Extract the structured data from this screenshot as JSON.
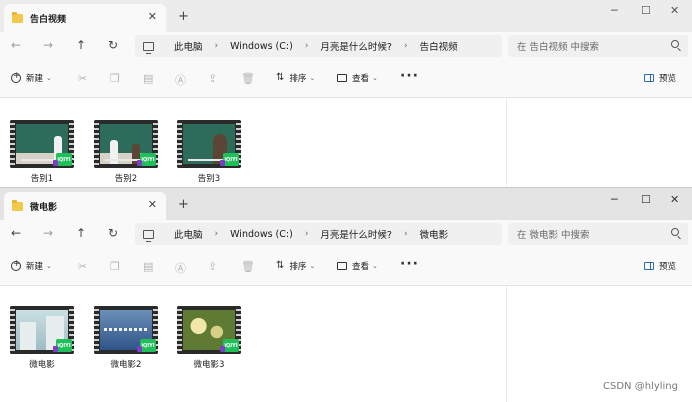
{
  "windows": [
    {
      "tab_title": "告白视频",
      "breadcrumb": [
        "此电脑",
        "Windows (C:)",
        "月亮是什么时候?",
        "告白视频"
      ],
      "search_placeholder": "在 告白视频 中搜索",
      "files": [
        {
          "name": "告别1",
          "thumbnail": "classroom-scene"
        },
        {
          "name": "告别2",
          "thumbnail": "classroom-scene"
        },
        {
          "name": "告别3",
          "thumbnail": "classroom-scene"
        }
      ]
    },
    {
      "tab_title": "微电影",
      "breadcrumb": [
        "此电脑",
        "Windows (C:)",
        "月亮是什么时候?",
        "微电影"
      ],
      "search_placeholder": "在 微电影 中搜索",
      "files": [
        {
          "name": "微电影",
          "thumbnail": "building-scene"
        },
        {
          "name": "微电影2",
          "thumbnail": "blue-title-scene"
        },
        {
          "name": "微电影3",
          "thumbnail": "flower-scene"
        }
      ]
    }
  ],
  "toolbar": {
    "new_label": "新建",
    "sort_label": "排序",
    "view_label": "查看",
    "preview_label": "预览"
  },
  "icons": {
    "tab": "folder-icon",
    "close": "close-icon",
    "new_tab": "plus-icon",
    "back": "arrow-left-icon",
    "forward": "arrow-right-icon",
    "up": "arrow-up-icon",
    "refresh": "refresh-icon",
    "computer": "computer-icon",
    "search": "search-icon",
    "video_badge": "iqiyi-badge-icon"
  },
  "badge_text": "iQIYI",
  "watermark": "CSDN @hlyling",
  "colors": {
    "badge": "#1fbf5a",
    "folder": "#f2c94c",
    "accent": "#2b6cb0"
  }
}
